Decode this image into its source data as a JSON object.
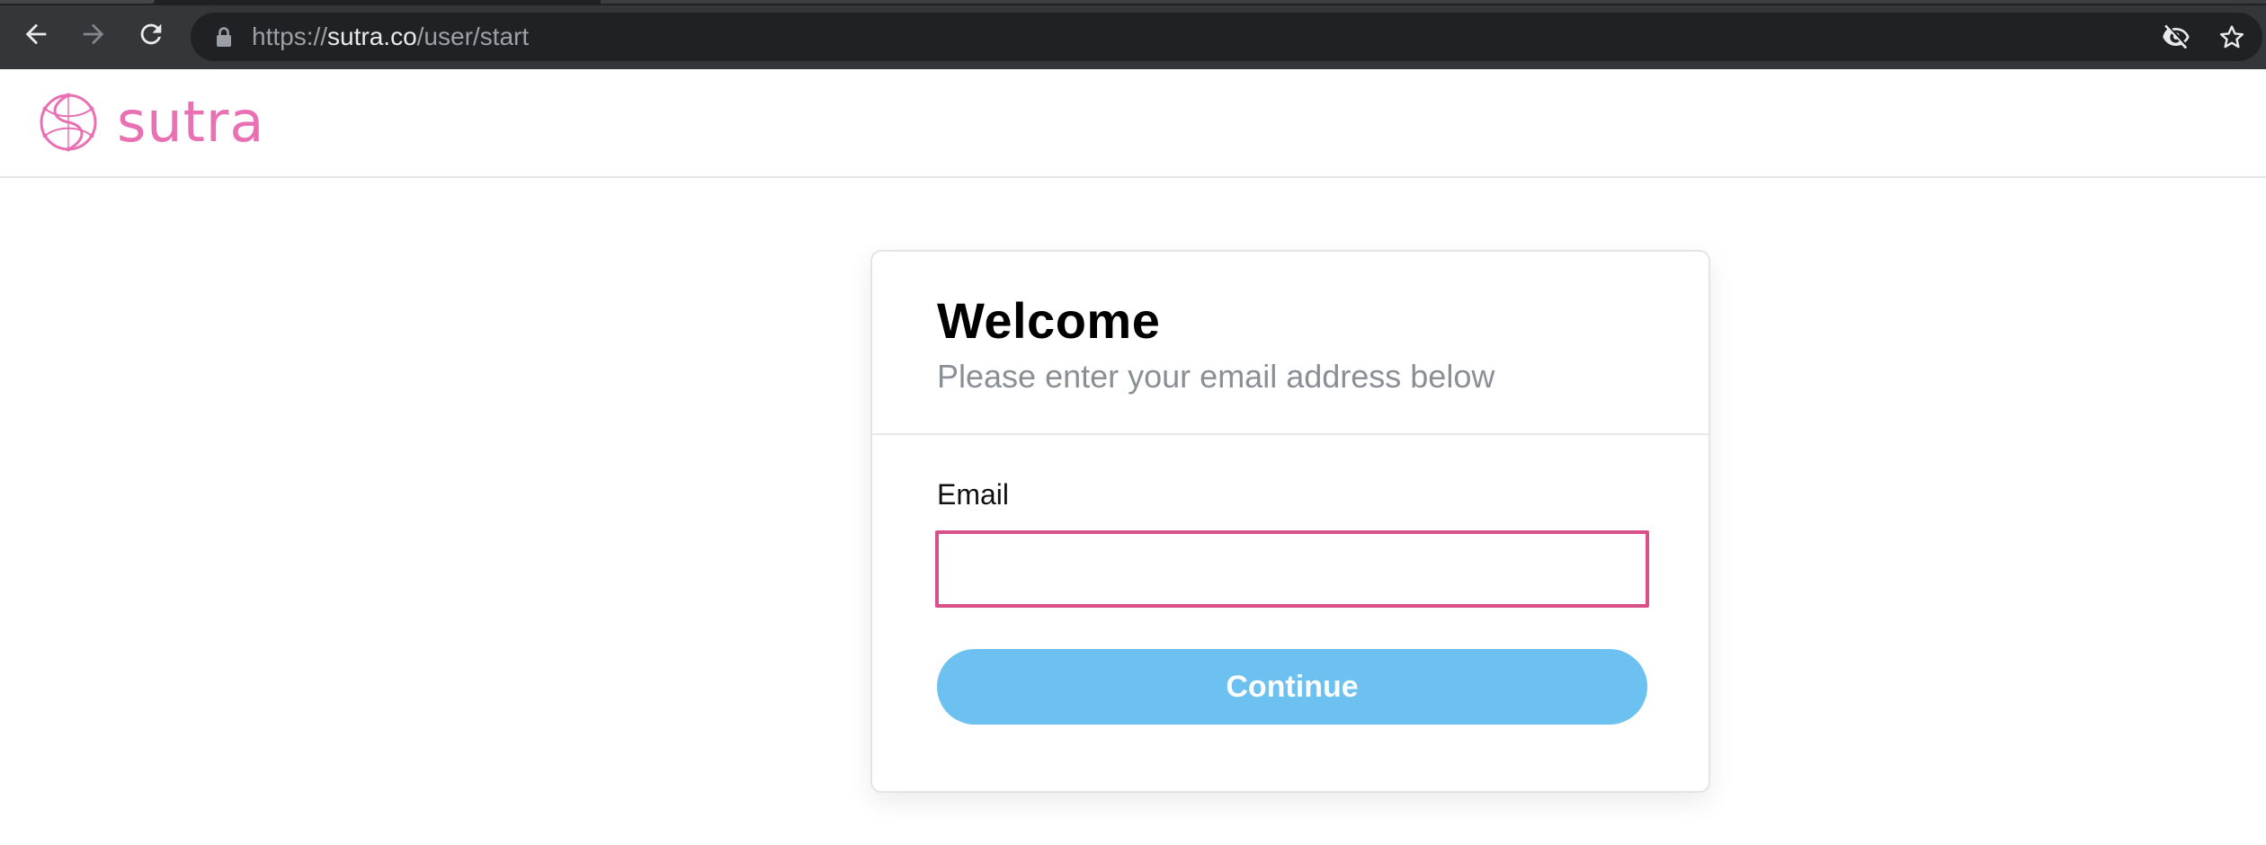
{
  "browser": {
    "url_scheme": "https://",
    "url_host": "sutra.co",
    "url_path": "/user/start"
  },
  "header": {
    "logo_text": "sutra",
    "brand_color": "#e870b3"
  },
  "card": {
    "title": "Welcome",
    "subtitle": "Please enter your email address below",
    "email_label": "Email",
    "email_value": "",
    "continue_label": "Continue"
  },
  "colors": {
    "input_border": "#d94f8a",
    "button_bg": "#6cc1f1",
    "chrome_bg": "#35363a",
    "omnibox_bg": "#202124"
  },
  "icons": {
    "back": "arrow-left-icon",
    "forward": "arrow-right-icon",
    "reload": "reload-icon",
    "lock": "lock-icon",
    "tracking": "eye-off-icon",
    "bookmark": "star-icon",
    "logo": "sutra-logo-icon"
  }
}
